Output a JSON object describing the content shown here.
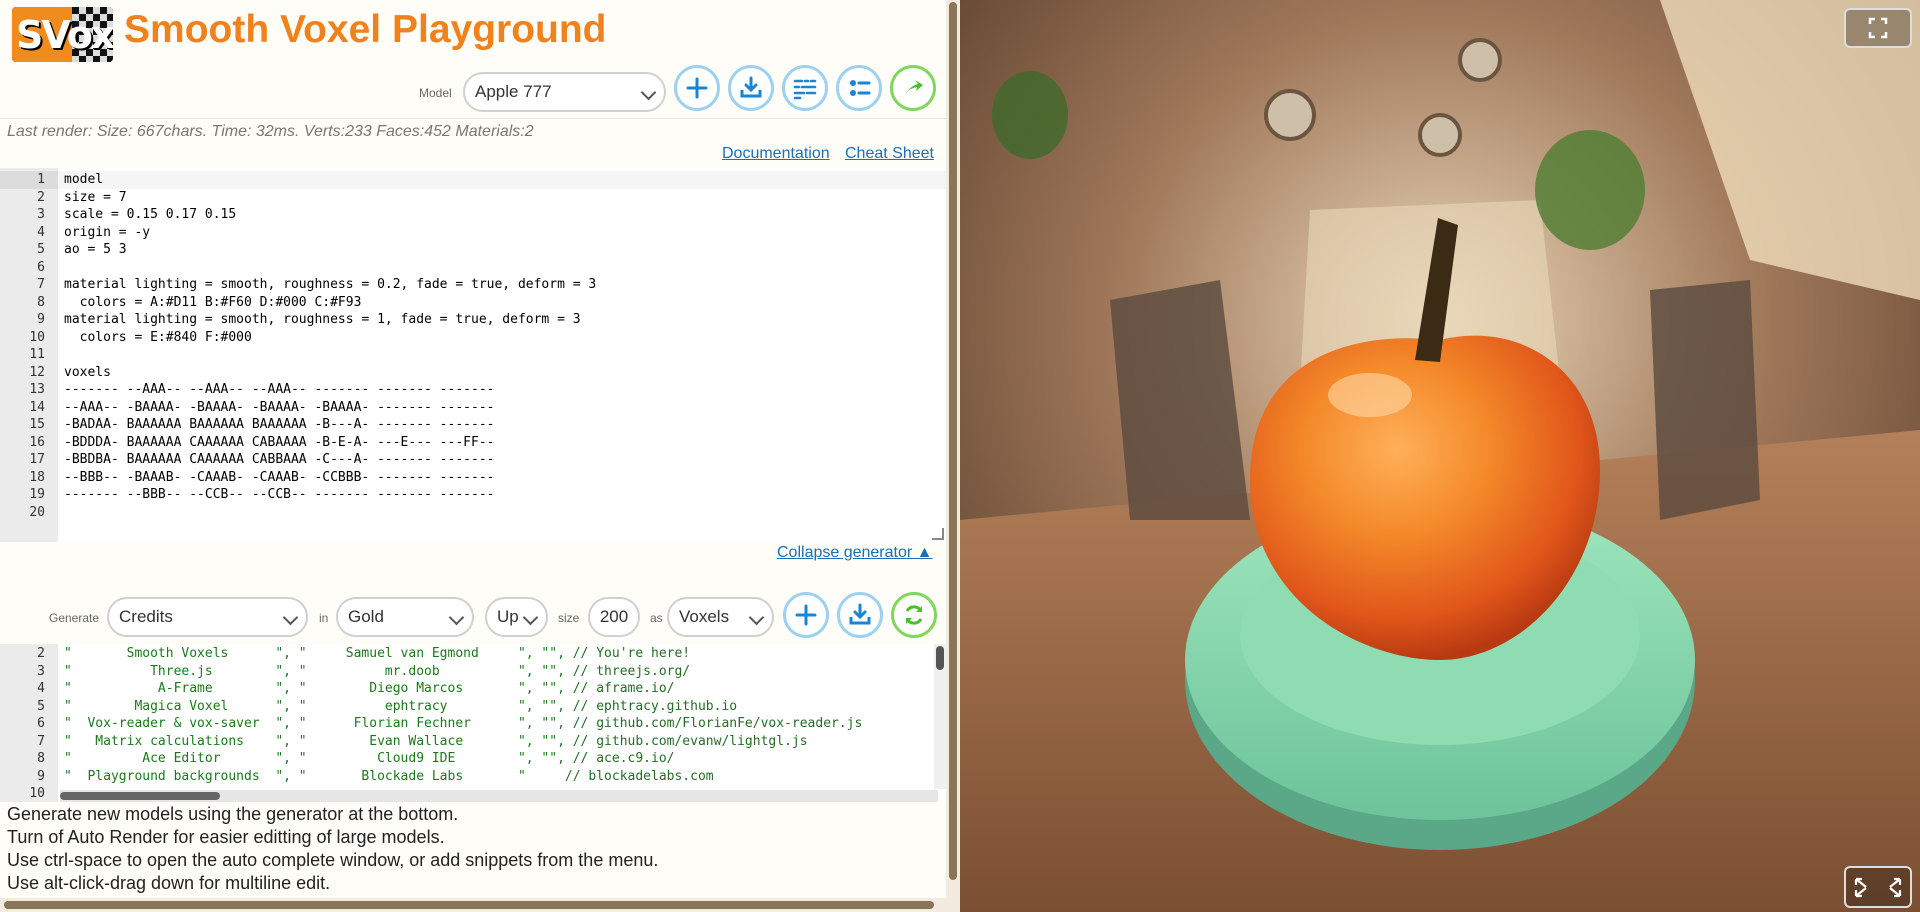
{
  "header": {
    "logo_text": "SVox",
    "app_title": "Smooth Voxel Playground",
    "model_label": "Model",
    "model_selected": "Apple 777",
    "buttons": {
      "new": "plus-icon",
      "download": "download-icon",
      "code": "code-icon",
      "settings": "settings-icon",
      "render": "arrow-right-icon"
    }
  },
  "status": {
    "last_render": "Last render: Size: 667chars. Time: 32ms. Verts:233 Faces:452 Materials:2",
    "documentation": "Documentation",
    "cheat_sheet": "Cheat Sheet"
  },
  "editor": {
    "lines": [
      {
        "n": "1",
        "t": "model"
      },
      {
        "n": "2",
        "t": "size = 7"
      },
      {
        "n": "3",
        "t": "scale = 0.15 0.17 0.15"
      },
      {
        "n": "4",
        "t": "origin = -y"
      },
      {
        "n": "5",
        "t": "ao = 5 3"
      },
      {
        "n": "6",
        "t": ""
      },
      {
        "n": "7",
        "t": "material lighting = smooth, roughness = 0.2, fade = true, deform = 3"
      },
      {
        "n": "8",
        "t": "  colors = A:#D11 B:#F60 D:#000 C:#F93"
      },
      {
        "n": "9",
        "t": "material lighting = smooth, roughness = 1, fade = true, deform = 3"
      },
      {
        "n": "10",
        "t": "  colors = E:#840 F:#000"
      },
      {
        "n": "11",
        "t": ""
      },
      {
        "n": "12",
        "t": "voxels"
      },
      {
        "n": "13",
        "t": "------- --AAA-- --AAA-- --AAA-- ------- ------- -------"
      },
      {
        "n": "14",
        "t": "--AAA-- -BAAAA- -BAAAA- -BAAAA- -BAAAA- ------- -------"
      },
      {
        "n": "15",
        "t": "-BADAA- BAAAAAA BAAAAAA BAAAAAA -B---A- ------- -------"
      },
      {
        "n": "16",
        "t": "-BDDDA- BAAAAAA CAAAAAA CABAAAA -B-E-A- ---E--- ---FF--"
      },
      {
        "n": "17",
        "t": "-BBDBA- BAAAAAA CAAAAAA CABBAAA -C---A- ------- -------"
      },
      {
        "n": "18",
        "t": "--BBB-- -BAAAB- -CAAAB- -CAAAB- -CCBBB- ------- -------"
      },
      {
        "n": "19",
        "t": "------- --BBB-- --CCB-- --CCB-- ------- ------- -------"
      },
      {
        "n": "20",
        "t": ""
      }
    ]
  },
  "generator": {
    "collapse_label": "Collapse generator ▲",
    "generate_label": "Generate",
    "generate_value": "Credits",
    "in_label": "in",
    "color_value": "Gold",
    "direction_value": "Up",
    "size_label": "size",
    "size_value": "200",
    "as_label": "as",
    "as_value": "Voxels"
  },
  "credits": {
    "lines": [
      {
        "n": "2",
        "a": "\"       Smooth Voxels      \", \"     Samuel van Egmond     \", \"\", ",
        "c": "// You're here!"
      },
      {
        "n": "3",
        "a": "\"          Three.js        \", \"          mr.doob          \", \"\", ",
        "c": "// threejs.org/"
      },
      {
        "n": "4",
        "a": "\"           A-Frame        \", \"        Diego Marcos       \", \"\", ",
        "c": "// aframe.io/"
      },
      {
        "n": "5",
        "a": "\"        Magica Voxel      \", \"          ephtracy         \", \"\", ",
        "c": "// ephtracy.github.io"
      },
      {
        "n": "6",
        "a": "\"  Vox-reader & vox-saver  \", \"      Florian Fechner      \", \"\", ",
        "c": "// github.com/FlorianFe/vox-reader.js"
      },
      {
        "n": "7",
        "a": "\"   Matrix calculations    \", \"        Evan Wallace       \", \"\", ",
        "c": "// github.com/evanw/lightgl.js"
      },
      {
        "n": "8",
        "a": "\"         Ace Editor       \", \"         Cloud9 IDE        \", \"\", ",
        "c": "// ace.c9.io/"
      },
      {
        "n": "9",
        "a": "\"  Playground backgrounds  \", \"       Blockade Labs       \"     ",
        "c": "// blockadelabs.com"
      },
      {
        "n": "10",
        "a": "",
        "c": ""
      }
    ]
  },
  "help": {
    "lines": [
      "Generate new models using the generator at the bottom.",
      "Turn of Auto Render for easier editting of large models.",
      "Use ctrl-space to open the auto complete window, or add snippets from the menu.",
      "Use alt-click-drag down for multiline edit."
    ]
  },
  "viewport": {
    "fullscreen_icon": "fullscreen-icon",
    "expand_icon": "expand-icon"
  },
  "colors": {
    "accent": "#f0821e",
    "link": "#1a6fb8",
    "button_border": "#9ed1ef",
    "render_border": "#7fd85a"
  }
}
